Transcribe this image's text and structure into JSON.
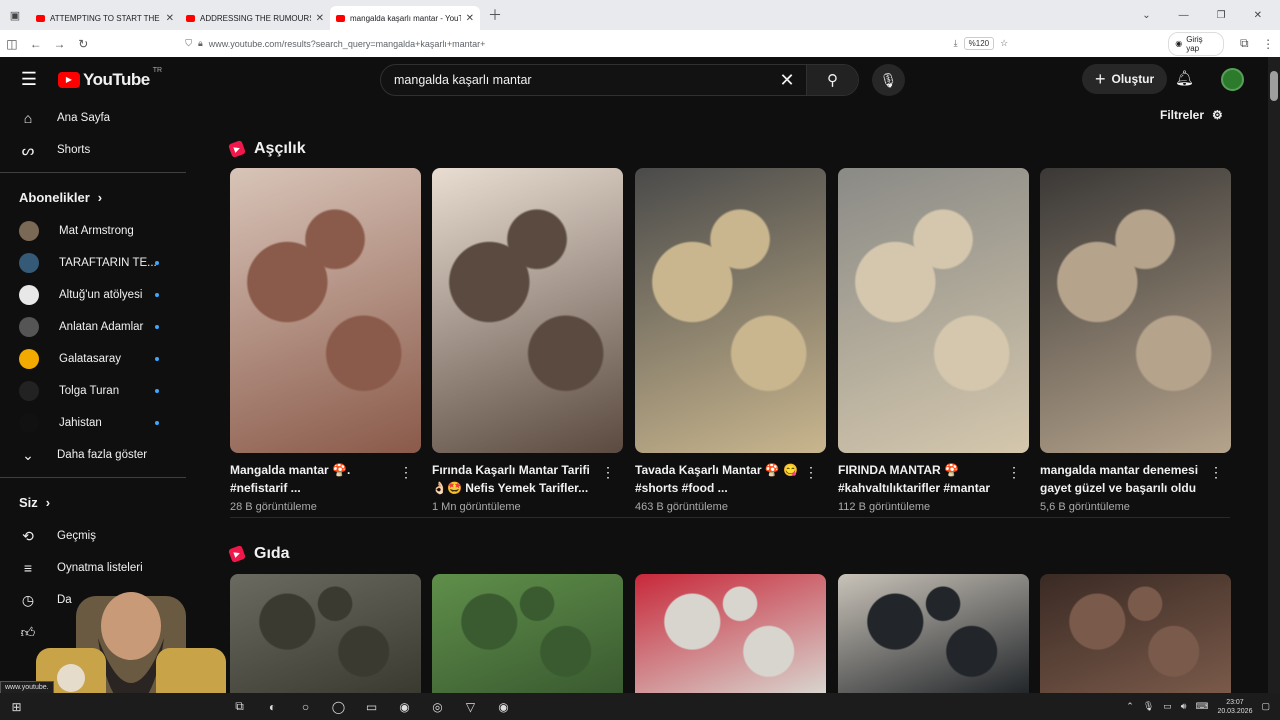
{
  "browser": {
    "tabs": [
      {
        "title": "ATTEMPTING TO START THE WI"
      },
      {
        "title": "ADDRESSING THE RUMOURS A"
      },
      {
        "title": "mangalda kaşarlı mantar - YouT"
      }
    ],
    "url": "www.youtube.com/results?search_query=mangalda+kaşarlı+mantar+",
    "zoom": "%120",
    "signin": "Giriş yap"
  },
  "youtube": {
    "logo": "YouTube",
    "region": "TR",
    "search_query": "mangalda kaşarlı mantar",
    "create": "Oluştur",
    "filters": "Filtreler"
  },
  "sidebar": {
    "main": [
      {
        "label": "Ana Sayfa"
      },
      {
        "label": "Shorts"
      }
    ],
    "subs_header": "Abonelikler",
    "subs": [
      {
        "label": "Mat Armstrong",
        "color": "#7a6a55",
        "dot": false
      },
      {
        "label": "TARAFTARIN TE...",
        "color": "#345a78",
        "dot": true
      },
      {
        "label": "Altuğ'un atölyesi",
        "color": "#e8e8e8",
        "dot": true
      },
      {
        "label": "Anlatan Adamlar",
        "color": "#555",
        "dot": true
      },
      {
        "label": "Galatasaray",
        "color": "#f2a900",
        "dot": true
      },
      {
        "label": "Tolga Turan",
        "color": "#222",
        "dot": true
      },
      {
        "label": "Jahistan",
        "color": "#111",
        "dot": true
      }
    ],
    "more": "Daha fazla göster",
    "you_header": "Siz",
    "you": [
      {
        "label": "Geçmiş"
      },
      {
        "label": "Oynatma listeleri"
      },
      {
        "label": "Da"
      }
    ]
  },
  "sections": [
    {
      "title": "Aşçılık",
      "cards": [
        {
          "title": "Mangalda mantar 🍄. #nefistarif ...",
          "views": "28 B görüntüleme",
          "c1": "#d8c4b8",
          "c2": "#8a5a4a"
        },
        {
          "title": "Fırında Kaşarlı Mantar Tarifi 👌🏻🤩 Nefis Yemek Tarifler...",
          "views": "1 Mn görüntüleme",
          "c1": "#e9ddd2",
          "c2": "#5a4a40"
        },
        {
          "title": "Tavada Kaşarlı Mantar 🍄 😋 #shorts #food ...",
          "views": "463 B görüntüleme",
          "c1": "#4a4a4a",
          "c2": "#c9b68e"
        },
        {
          "title": "FIRINDA MANTAR 🍄 #kahvaltılıktarifler #mantar",
          "views": "112 B görüntüleme",
          "c1": "#8a8a86",
          "c2": "#d4c7ad"
        },
        {
          "title": "mangalda mantar denemesi gayet güzel ve başarılı oldu",
          "views": "5,6 B görüntüleme",
          "c1": "#3a3836",
          "c2": "#b5a38c"
        }
      ]
    },
    {
      "title": "Gıda",
      "cards": [
        {
          "c1": "#6a6a60",
          "c2": "#3a3a30"
        },
        {
          "c1": "#5f8f4a",
          "c2": "#3a5a30"
        },
        {
          "c1": "#c8283a",
          "c2": "#d8d4ce"
        },
        {
          "c1": "#c9c3b9",
          "c2": "#22262a"
        },
        {
          "c1": "#3a2a24",
          "c2": "#7a5a4a"
        }
      ]
    }
  ],
  "status_url": "www.youtube.",
  "clock": {
    "time": "23:07",
    "date": "20.03.2026"
  }
}
